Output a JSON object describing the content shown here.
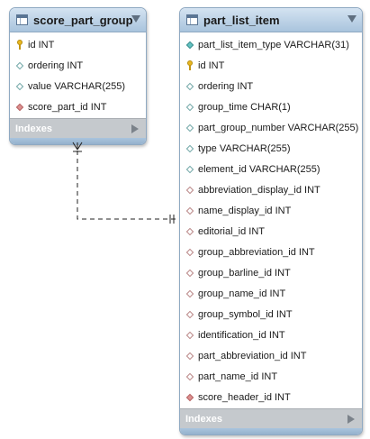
{
  "tables": [
    {
      "title": "score_part_group",
      "footer": "Indexes",
      "columns": [
        {
          "text": "id INT",
          "icon": "primary-key-icon"
        },
        {
          "text": "ordering INT",
          "icon": "column-diamond-icon"
        },
        {
          "text": "value VARCHAR(255)",
          "icon": "column-diamond-icon"
        },
        {
          "text": "score_part_id INT",
          "icon": "foreign-key-icon"
        }
      ]
    },
    {
      "title": "part_list_item",
      "footer": "Indexes",
      "columns": [
        {
          "text": "part_list_item_type VARCHAR(31)",
          "icon": "not-null-column-icon"
        },
        {
          "text": "id INT",
          "icon": "primary-key-icon"
        },
        {
          "text": "ordering INT",
          "icon": "column-diamond-icon"
        },
        {
          "text": "group_time CHAR(1)",
          "icon": "column-diamond-icon"
        },
        {
          "text": "part_group_number VARCHAR(255)",
          "icon": "column-diamond-icon"
        },
        {
          "text": "type VARCHAR(255)",
          "icon": "column-diamond-icon"
        },
        {
          "text": "element_id VARCHAR(255)",
          "icon": "column-diamond-icon"
        },
        {
          "text": "abbreviation_display_id INT",
          "icon": "nullable-foreign-key-icon"
        },
        {
          "text": "name_display_id INT",
          "icon": "nullable-foreign-key-icon"
        },
        {
          "text": "editorial_id INT",
          "icon": "nullable-foreign-key-icon"
        },
        {
          "text": "group_abbreviation_id INT",
          "icon": "nullable-foreign-key-icon"
        },
        {
          "text": "group_barline_id INT",
          "icon": "nullable-foreign-key-icon"
        },
        {
          "text": "group_name_id INT",
          "icon": "nullable-foreign-key-icon"
        },
        {
          "text": "group_symbol_id INT",
          "icon": "nullable-foreign-key-icon"
        },
        {
          "text": "identification_id INT",
          "icon": "nullable-foreign-key-icon"
        },
        {
          "text": "part_abbreviation_id INT",
          "icon": "nullable-foreign-key-icon"
        },
        {
          "text": "part_name_id INT",
          "icon": "nullable-foreign-key-icon"
        },
        {
          "text": "score_header_id INT",
          "icon": "foreign-key-icon"
        }
      ]
    }
  ]
}
